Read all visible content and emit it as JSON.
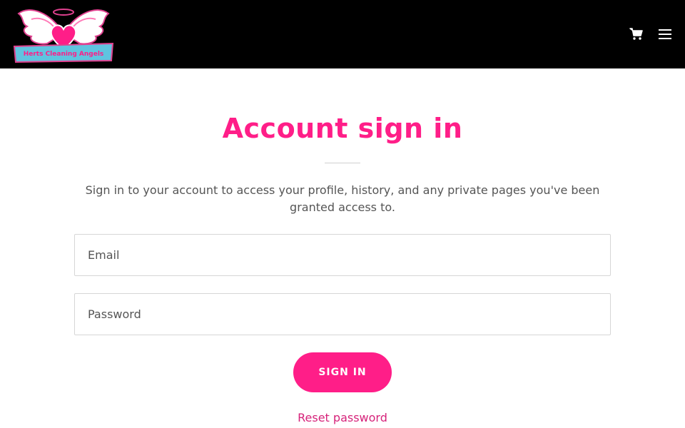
{
  "header": {
    "logo_text": "Herts Cleaning Angels",
    "cart_icon": "cart-icon",
    "menu_icon": "hamburger-menu-icon"
  },
  "main": {
    "title": "Account sign in",
    "subtitle": "Sign in to your account to access your profile, history, and any private pages you've been granted access to.",
    "email_placeholder": "Email",
    "password_placeholder": "Password",
    "signin_label": "SIGN IN",
    "reset_label": "Reset password"
  },
  "colors": {
    "accent": "#ff1e88",
    "header_bg": "#000000",
    "link": "#d6237a"
  }
}
